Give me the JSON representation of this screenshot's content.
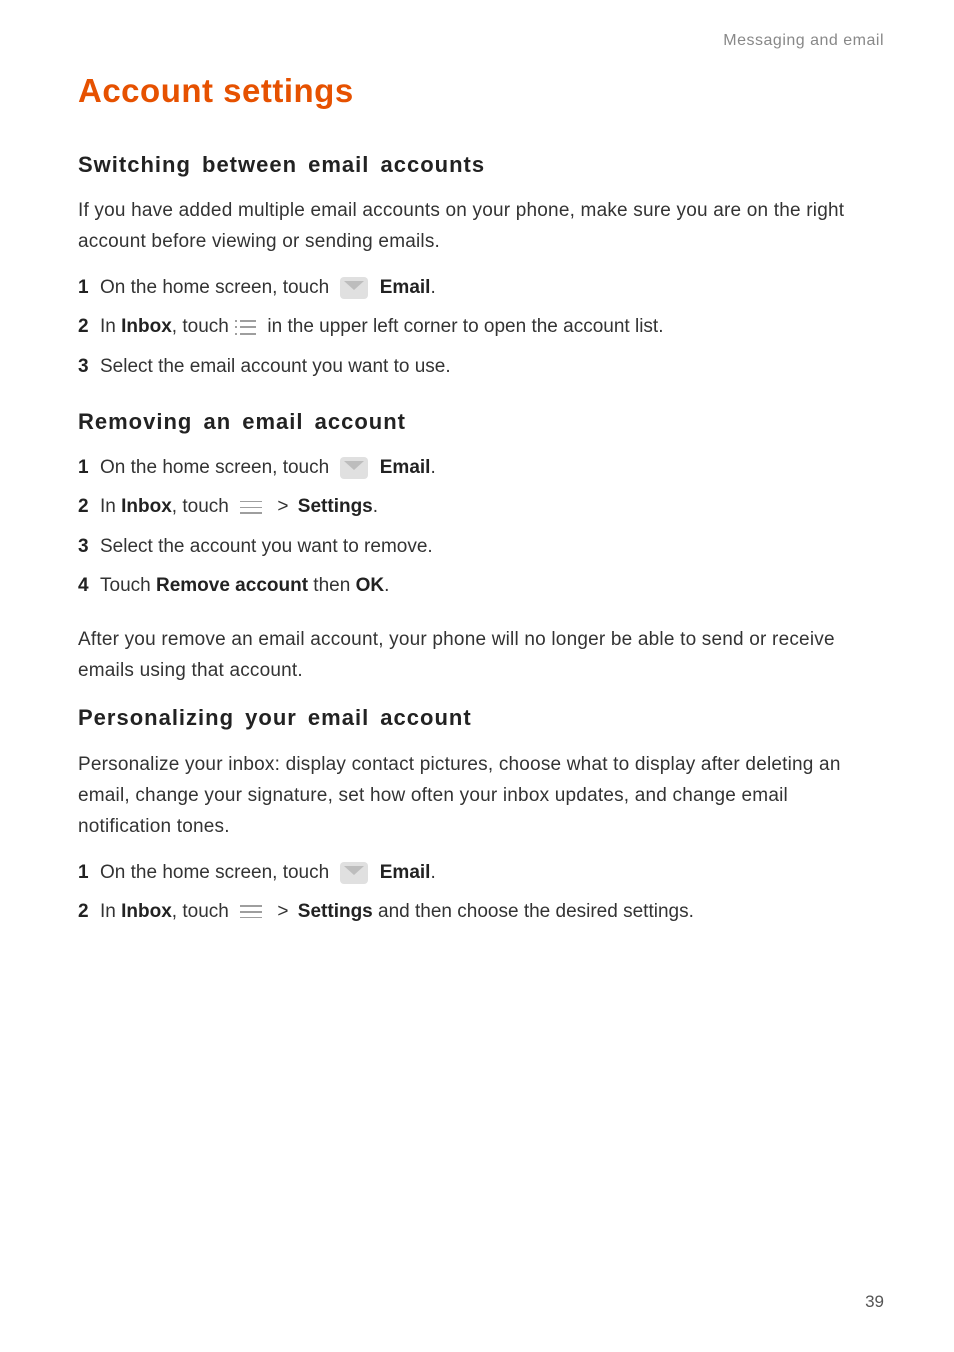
{
  "runningHeader": "Messaging and email",
  "pageNumber": "39",
  "title": "Account settings",
  "sections": [
    {
      "heading": "Switching  between  email  accounts",
      "intro": "If you have added multiple email accounts on your phone, make sure you are on the right account before viewing or sending emails.",
      "steps": [
        {
          "num": "1",
          "parts": [
            {
              "t": "On the home screen, touch "
            },
            {
              "icon": "email"
            },
            {
              "t": " "
            },
            {
              "t": "Email",
              "bold": true
            },
            {
              "t": "."
            }
          ]
        },
        {
          "num": "2",
          "parts": [
            {
              "t": "In "
            },
            {
              "t": "Inbox",
              "bold": true
            },
            {
              "t": ", touch "
            },
            {
              "icon": "list"
            },
            {
              "t": " in the upper left corner to open the account list."
            }
          ]
        },
        {
          "num": "3",
          "parts": [
            {
              "t": "Select the email account you want to use."
            }
          ]
        }
      ]
    },
    {
      "heading": "Removing  an  email  account",
      "steps": [
        {
          "num": "1",
          "parts": [
            {
              "t": "On the home screen, touch "
            },
            {
              "icon": "email"
            },
            {
              "t": " "
            },
            {
              "t": "Email",
              "bold": true
            },
            {
              "t": "."
            }
          ]
        },
        {
          "num": "2",
          "parts": [
            {
              "t": "In "
            },
            {
              "t": "Inbox",
              "bold": true
            },
            {
              "t": ", touch "
            },
            {
              "icon": "menu"
            },
            {
              "t": " "
            },
            {
              "gt": true
            },
            {
              "t": " "
            },
            {
              "t": "Settings",
              "bold": true
            },
            {
              "t": "."
            }
          ]
        },
        {
          "num": "3",
          "parts": [
            {
              "t": "Select the account you want to remove."
            }
          ]
        },
        {
          "num": "4",
          "parts": [
            {
              "t": "Touch "
            },
            {
              "t": "Remove account",
              "bold": true
            },
            {
              "t": " then "
            },
            {
              "t": "OK",
              "bold": true
            },
            {
              "t": "."
            }
          ]
        }
      ],
      "outro": "After you remove an email account, your phone will no longer be able to send or receive emails using that account."
    },
    {
      "heading": "Personalizing  your  email  account",
      "intro": "Personalize your inbox: display contact pictures, choose what to display after deleting an email, change your signature, set how often your inbox updates, and change email notification tones.",
      "steps": [
        {
          "num": "1",
          "parts": [
            {
              "t": "On the home screen, touch "
            },
            {
              "icon": "email"
            },
            {
              "t": " "
            },
            {
              "t": "Email",
              "bold": true
            },
            {
              "t": "."
            }
          ]
        },
        {
          "num": "2",
          "parts": [
            {
              "t": "In "
            },
            {
              "t": "Inbox",
              "bold": true
            },
            {
              "t": ", touch "
            },
            {
              "icon": "menu"
            },
            {
              "t": " "
            },
            {
              "gt": true
            },
            {
              "t": " "
            },
            {
              "t": "Settings",
              "bold": true
            },
            {
              "t": " and then choose the desired settings."
            }
          ]
        }
      ]
    }
  ]
}
